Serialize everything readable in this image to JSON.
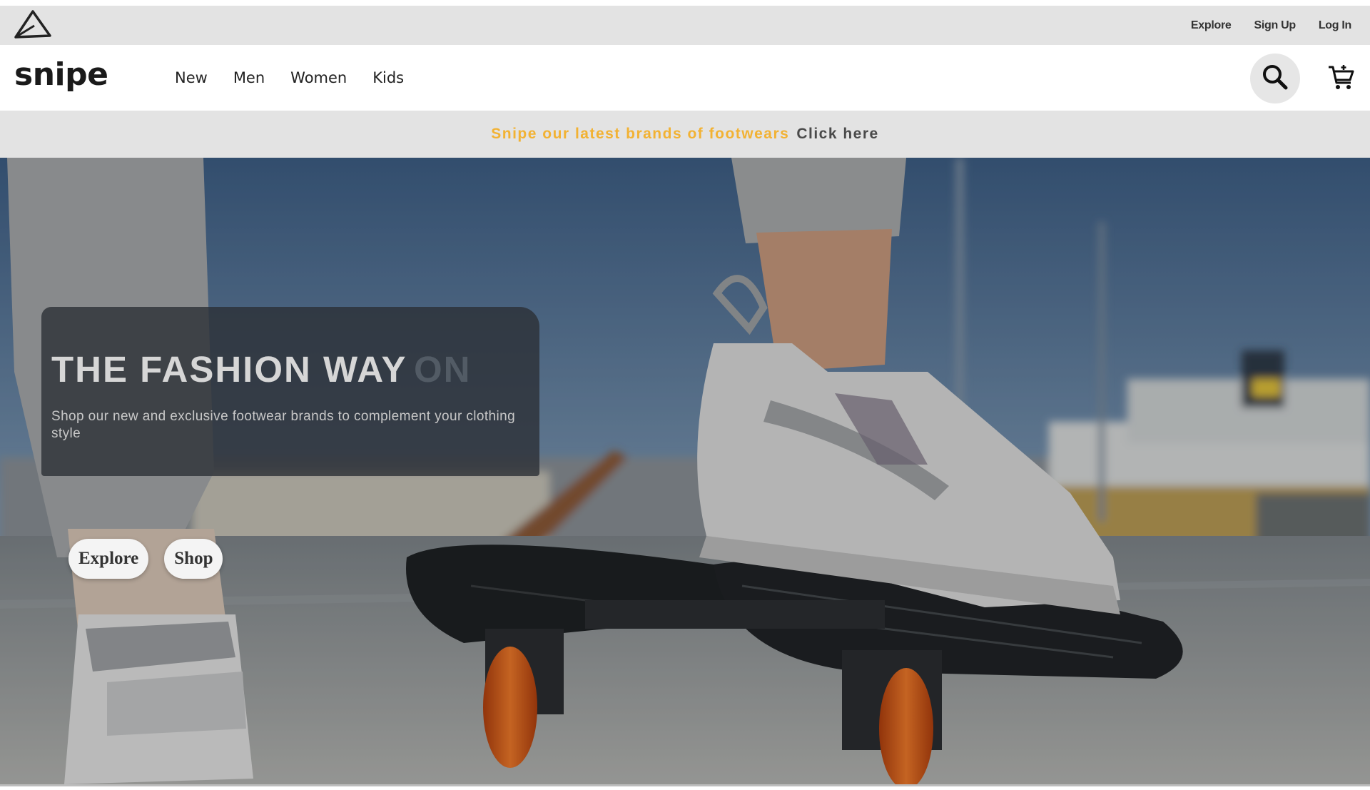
{
  "utility_bar": {
    "logo_icon": "triangle-logo-icon",
    "links": [
      "Explore",
      "Sign Up",
      "Log In"
    ]
  },
  "nav": {
    "brand": "snipe",
    "links": [
      "New",
      "Men",
      "Women",
      "Kids"
    ],
    "search_icon": "search-icon",
    "cart_icon": "cart-icon"
  },
  "promo": {
    "text": "Snipe our latest brands of footwears",
    "link": "Click here",
    "text_color": "#f2b233"
  },
  "hero": {
    "title": "THE FASHION WAY",
    "title_ghost": "ON",
    "subtitle": "Shop our new and exclusive footwear brands to complement your clothing style",
    "buttons": {
      "explore": "Explore",
      "shop": "Shop"
    },
    "image": "skateboard-sneaker-photo"
  },
  "colors": {
    "bar_gray": "#e3e3e3",
    "card_overlay": "#2c3036",
    "accent": "#f2b233"
  }
}
